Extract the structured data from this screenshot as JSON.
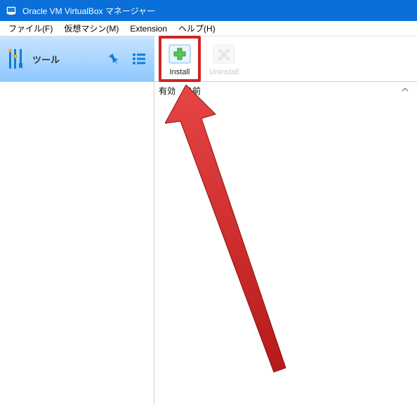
{
  "title": "Oracle VM VirtualBox マネージャー",
  "menu": {
    "file": "ファイル(F)",
    "machine": "仮想マシン(M)",
    "extension": "Extension",
    "help": "ヘルプ(H)"
  },
  "toolbar": {
    "tools_label": "ツール",
    "install_label": "Install",
    "uninstall_label": "Uninstall"
  },
  "columns": {
    "enabled": "有効",
    "name": "名前"
  }
}
